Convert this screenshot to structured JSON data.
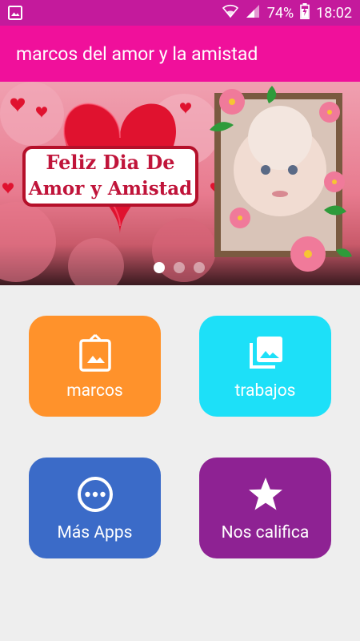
{
  "status_bar": {
    "battery": "74%",
    "time": "18:02",
    "icons": [
      "gallery-notification-icon",
      "wifi-icon",
      "signal-icon",
      "battery-charging-icon"
    ]
  },
  "app_bar": {
    "title": "marcos del amor y la amistad",
    "color": "#f0109b"
  },
  "banner": {
    "greeting_line1": "Feliz Dia De",
    "greeting_line2": "Amor y Amistad",
    "dots": 3,
    "active_dot": 0
  },
  "tiles": [
    {
      "id": "marcos",
      "label": "marcos",
      "icon": "portrait-frame-icon",
      "color": "#ff922b"
    },
    {
      "id": "trabajos",
      "label": "trabajos",
      "icon": "photo-library-icon",
      "color": "#1de0f8"
    },
    {
      "id": "mas-apps",
      "label": "Más Apps",
      "icon": "more-apps-icon",
      "color": "#3b6bc8"
    },
    {
      "id": "nos-califica",
      "label": "Nos califica",
      "icon": "star-icon",
      "color": "#8e2293"
    }
  ]
}
